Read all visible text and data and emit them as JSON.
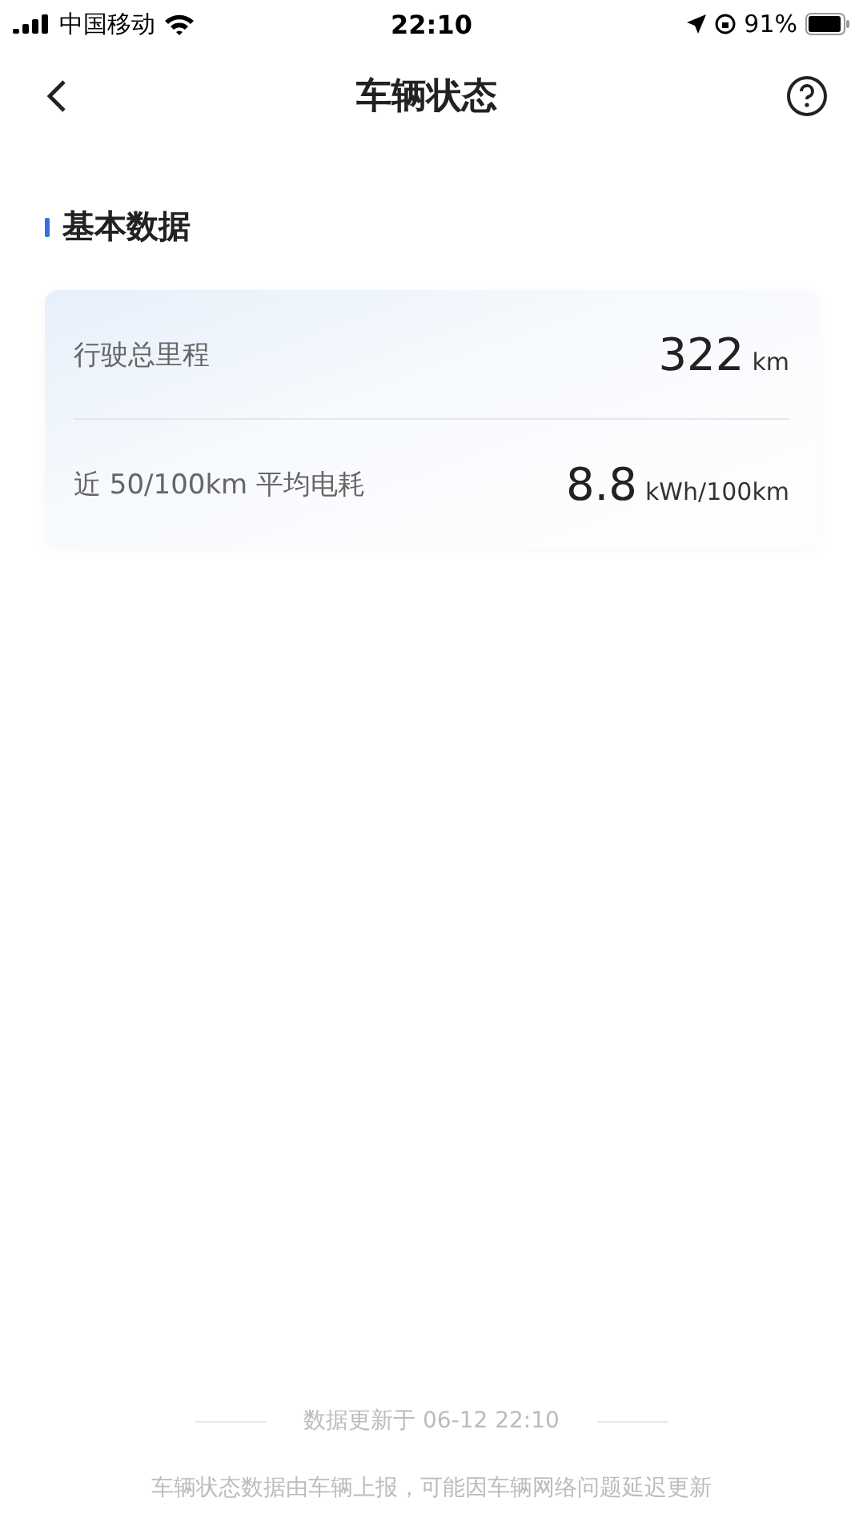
{
  "status_bar": {
    "carrier": "中国移动",
    "time": "22:10",
    "battery": "91%"
  },
  "nav": {
    "title": "车辆状态"
  },
  "section": {
    "title": "基本数据"
  },
  "rows": [
    {
      "label": "行驶总里程",
      "value": "322",
      "unit": "km"
    },
    {
      "label": "近 50/100km 平均电耗",
      "value": "8.8",
      "unit": "kWh/100km"
    }
  ],
  "footer": {
    "updated": "数据更新于 06-12 22:10",
    "note": "车辆状态数据由车辆上报，可能因车辆网络问题延迟更新"
  }
}
